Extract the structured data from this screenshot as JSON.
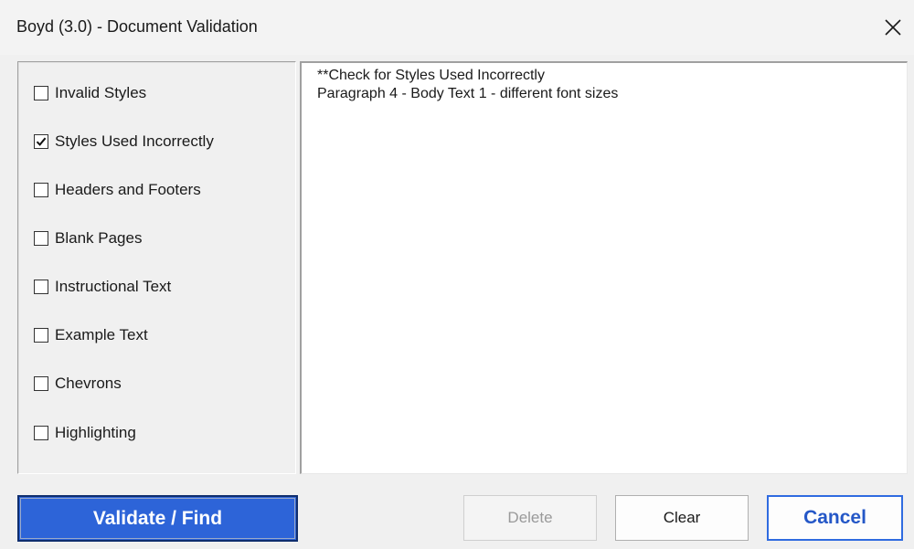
{
  "window": {
    "title": "Boyd (3.0) - Document Validation",
    "close_icon": "close-icon"
  },
  "checks": [
    {
      "label": "Invalid Styles",
      "checked": false
    },
    {
      "label": "Styles Used Incorrectly",
      "checked": true
    },
    {
      "label": "Headers and Footers",
      "checked": false
    },
    {
      "label": "Blank Pages",
      "checked": false
    },
    {
      "label": "Instructional Text",
      "checked": false
    },
    {
      "label": "Example Text",
      "checked": false
    },
    {
      "label": "Chevrons",
      "checked": false
    },
    {
      "label": "Highlighting",
      "checked": false
    }
  ],
  "results": {
    "lines": [
      "**Check for Styles Used Incorrectly",
      "Paragraph 4 - Body Text 1 - different font sizes"
    ]
  },
  "buttons": {
    "validate": "Validate / Find",
    "delete": "Delete",
    "clear": "Clear",
    "cancel": "Cancel"
  },
  "colors": {
    "validate_bg": "#2d64d8",
    "cancel_text": "#2457c7"
  }
}
